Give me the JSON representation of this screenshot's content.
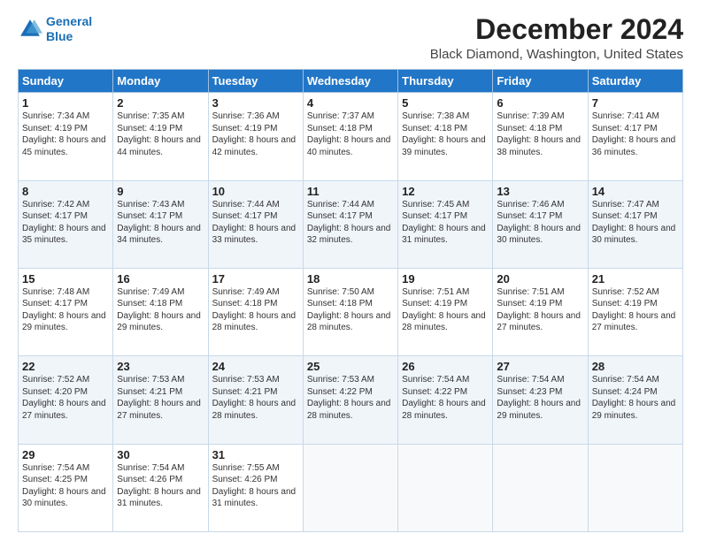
{
  "logo": {
    "line1": "General",
    "line2": "Blue"
  },
  "title": "December 2024",
  "subtitle": "Black Diamond, Washington, United States",
  "headers": [
    "Sunday",
    "Monday",
    "Tuesday",
    "Wednesday",
    "Thursday",
    "Friday",
    "Saturday"
  ],
  "weeks": [
    [
      {
        "day": "1",
        "sunrise": "7:34 AM",
        "sunset": "4:19 PM",
        "daylight": "8 hours and 45 minutes."
      },
      {
        "day": "2",
        "sunrise": "7:35 AM",
        "sunset": "4:19 PM",
        "daylight": "8 hours and 44 minutes."
      },
      {
        "day": "3",
        "sunrise": "7:36 AM",
        "sunset": "4:19 PM",
        "daylight": "8 hours and 42 minutes."
      },
      {
        "day": "4",
        "sunrise": "7:37 AM",
        "sunset": "4:18 PM",
        "daylight": "8 hours and 40 minutes."
      },
      {
        "day": "5",
        "sunrise": "7:38 AM",
        "sunset": "4:18 PM",
        "daylight": "8 hours and 39 minutes."
      },
      {
        "day": "6",
        "sunrise": "7:39 AM",
        "sunset": "4:18 PM",
        "daylight": "8 hours and 38 minutes."
      },
      {
        "day": "7",
        "sunrise": "7:41 AM",
        "sunset": "4:17 PM",
        "daylight": "8 hours and 36 minutes."
      }
    ],
    [
      {
        "day": "8",
        "sunrise": "7:42 AM",
        "sunset": "4:17 PM",
        "daylight": "8 hours and 35 minutes."
      },
      {
        "day": "9",
        "sunrise": "7:43 AM",
        "sunset": "4:17 PM",
        "daylight": "8 hours and 34 minutes."
      },
      {
        "day": "10",
        "sunrise": "7:44 AM",
        "sunset": "4:17 PM",
        "daylight": "8 hours and 33 minutes."
      },
      {
        "day": "11",
        "sunrise": "7:44 AM",
        "sunset": "4:17 PM",
        "daylight": "8 hours and 32 minutes."
      },
      {
        "day": "12",
        "sunrise": "7:45 AM",
        "sunset": "4:17 PM",
        "daylight": "8 hours and 31 minutes."
      },
      {
        "day": "13",
        "sunrise": "7:46 AM",
        "sunset": "4:17 PM",
        "daylight": "8 hours and 30 minutes."
      },
      {
        "day": "14",
        "sunrise": "7:47 AM",
        "sunset": "4:17 PM",
        "daylight": "8 hours and 30 minutes."
      }
    ],
    [
      {
        "day": "15",
        "sunrise": "7:48 AM",
        "sunset": "4:17 PM",
        "daylight": "8 hours and 29 minutes."
      },
      {
        "day": "16",
        "sunrise": "7:49 AM",
        "sunset": "4:18 PM",
        "daylight": "8 hours and 29 minutes."
      },
      {
        "day": "17",
        "sunrise": "7:49 AM",
        "sunset": "4:18 PM",
        "daylight": "8 hours and 28 minutes."
      },
      {
        "day": "18",
        "sunrise": "7:50 AM",
        "sunset": "4:18 PM",
        "daylight": "8 hours and 28 minutes."
      },
      {
        "day": "19",
        "sunrise": "7:51 AM",
        "sunset": "4:19 PM",
        "daylight": "8 hours and 28 minutes."
      },
      {
        "day": "20",
        "sunrise": "7:51 AM",
        "sunset": "4:19 PM",
        "daylight": "8 hours and 27 minutes."
      },
      {
        "day": "21",
        "sunrise": "7:52 AM",
        "sunset": "4:19 PM",
        "daylight": "8 hours and 27 minutes."
      }
    ],
    [
      {
        "day": "22",
        "sunrise": "7:52 AM",
        "sunset": "4:20 PM",
        "daylight": "8 hours and 27 minutes."
      },
      {
        "day": "23",
        "sunrise": "7:53 AM",
        "sunset": "4:21 PM",
        "daylight": "8 hours and 27 minutes."
      },
      {
        "day": "24",
        "sunrise": "7:53 AM",
        "sunset": "4:21 PM",
        "daylight": "8 hours and 28 minutes."
      },
      {
        "day": "25",
        "sunrise": "7:53 AM",
        "sunset": "4:22 PM",
        "daylight": "8 hours and 28 minutes."
      },
      {
        "day": "26",
        "sunrise": "7:54 AM",
        "sunset": "4:22 PM",
        "daylight": "8 hours and 28 minutes."
      },
      {
        "day": "27",
        "sunrise": "7:54 AM",
        "sunset": "4:23 PM",
        "daylight": "8 hours and 29 minutes."
      },
      {
        "day": "28",
        "sunrise": "7:54 AM",
        "sunset": "4:24 PM",
        "daylight": "8 hours and 29 minutes."
      }
    ],
    [
      {
        "day": "29",
        "sunrise": "7:54 AM",
        "sunset": "4:25 PM",
        "daylight": "8 hours and 30 minutes."
      },
      {
        "day": "30",
        "sunrise": "7:54 AM",
        "sunset": "4:26 PM",
        "daylight": "8 hours and 31 minutes."
      },
      {
        "day": "31",
        "sunrise": "7:55 AM",
        "sunset": "4:26 PM",
        "daylight": "8 hours and 31 minutes."
      },
      null,
      null,
      null,
      null
    ]
  ],
  "labels": {
    "sunrise": "Sunrise:",
    "sunset": "Sunset:",
    "daylight": "Daylight:"
  }
}
